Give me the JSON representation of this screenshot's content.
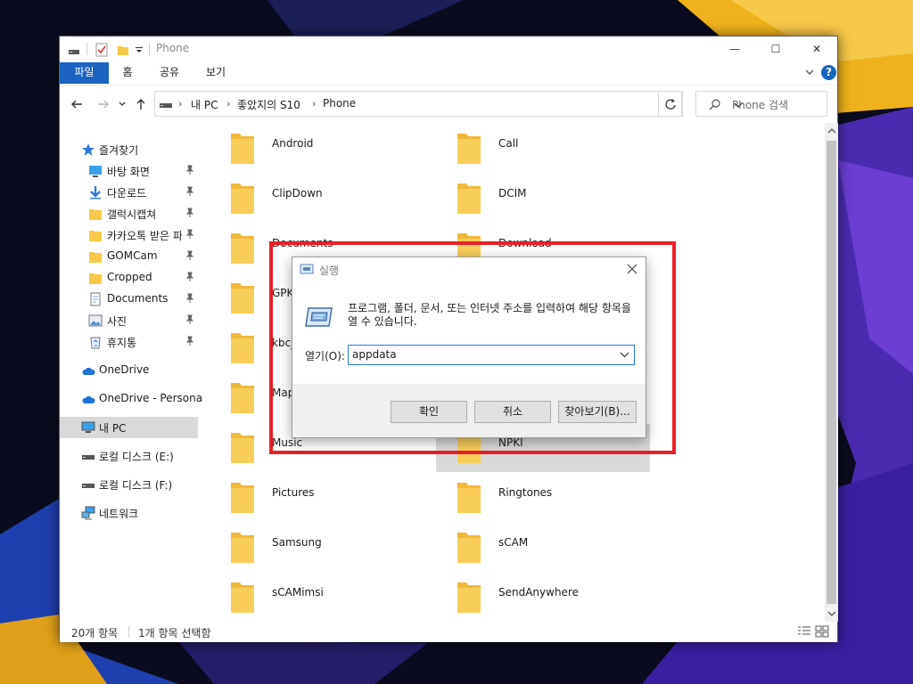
{
  "window": {
    "title": "Phone",
    "minimize_glyph": "—",
    "maximize_glyph": "☐",
    "close_glyph": "✕"
  },
  "ribbon": {
    "tabs": [
      "파일",
      "홈",
      "공유",
      "보기"
    ],
    "help_glyph": "?"
  },
  "address": {
    "crumbs": [
      "내 PC",
      "좋았지의 S10",
      "Phone"
    ],
    "search_placeholder": "Phone 검색"
  },
  "sidebar": {
    "quick_access": "즐겨찾기",
    "items": [
      {
        "label": "바탕 화면",
        "icon": "desktop-icon",
        "pinned": true
      },
      {
        "label": "다운로드",
        "icon": "download-icon",
        "pinned": true
      },
      {
        "label": "갤럭시캡쳐",
        "icon": "folder-icon",
        "pinned": true
      },
      {
        "label": "카카오톡 받은 파",
        "icon": "folder-icon",
        "pinned": true
      },
      {
        "label": "GOMCam",
        "icon": "folder-icon",
        "pinned": true
      },
      {
        "label": "Cropped",
        "icon": "folder-icon",
        "pinned": true
      },
      {
        "label": "Documents",
        "icon": "documents-icon",
        "pinned": true
      },
      {
        "label": "사진",
        "icon": "pictures-icon",
        "pinned": true
      },
      {
        "label": "휴지통",
        "icon": "recycle-bin-icon",
        "pinned": true
      }
    ],
    "onedrive": "OneDrive",
    "onedrive_personal": "OneDrive - Personal",
    "this_pc": "내 PC",
    "drive_e": "로컬 디스크 (E:)",
    "drive_f": "로컬 디스크 (F:)",
    "network": "네트워크"
  },
  "folders": [
    "Android",
    "Call",
    "ClipDown",
    "DCIM",
    "Documents",
    "Download",
    "GPKI",
    "",
    "kbc_d",
    "",
    "Mapp",
    "",
    "Music",
    "NPKI",
    "Pictures",
    "Ringtones",
    "Samsung",
    "sCAM",
    "sCAMimsi",
    "SendAnywhere"
  ],
  "selected_folder": "NPKI",
  "status": {
    "item_count": "20개 항목",
    "selected_count": "1개 항목 선택함"
  },
  "run_dialog": {
    "title": "실행",
    "description": "프로그램, 폴더, 문서, 또는 인터넷 주소를 입력하여 해당 항목을 열 수 있습니다.",
    "open_label": "열기(O):",
    "open_value": "appdata",
    "ok": "확인",
    "cancel": "취소",
    "browse": "찾아보기(B)..."
  },
  "colors": {
    "accent": "#1a63c0",
    "highlight": "#e8202a",
    "folder": "#f7c948"
  }
}
